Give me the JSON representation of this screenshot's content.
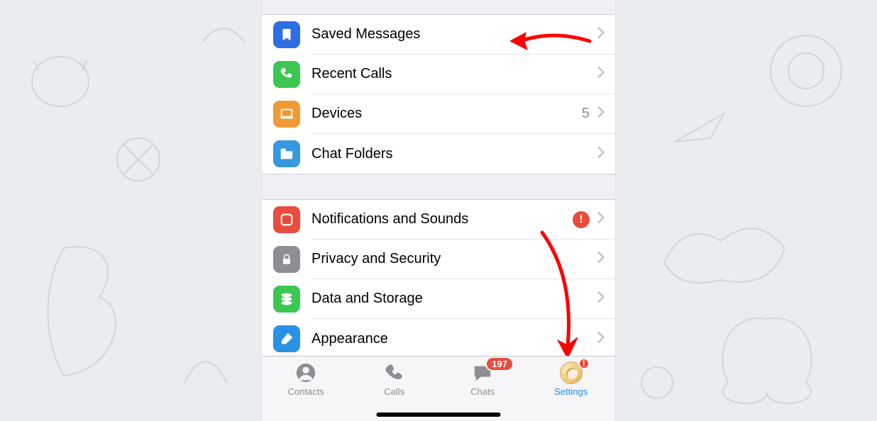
{
  "groups": [
    {
      "rows": [
        {
          "id": "saved-messages",
          "label": "Saved Messages",
          "iconClass": "ic-blue",
          "icon": "bookmark"
        },
        {
          "id": "recent-calls",
          "label": "Recent Calls",
          "iconClass": "ic-green2",
          "icon": "phone"
        },
        {
          "id": "devices",
          "label": "Devices",
          "iconClass": "ic-orange",
          "icon": "laptop",
          "detail": "5"
        },
        {
          "id": "chat-folders",
          "label": "Chat Folders",
          "iconClass": "ic-blue2",
          "icon": "folder"
        }
      ]
    },
    {
      "rows": [
        {
          "id": "notifications",
          "label": "Notifications and Sounds",
          "iconClass": "ic-red",
          "icon": "bell",
          "alert": "!"
        },
        {
          "id": "privacy",
          "label": "Privacy and Security",
          "iconClass": "ic-grey",
          "icon": "lock"
        },
        {
          "id": "data-storage",
          "label": "Data and Storage",
          "iconClass": "ic-green",
          "icon": "db"
        },
        {
          "id": "appearance",
          "label": "Appearance",
          "iconClass": "ic-blue3",
          "icon": "brush"
        }
      ]
    }
  ],
  "tabs": {
    "contacts": {
      "label": "Contacts"
    },
    "calls": {
      "label": "Calls"
    },
    "chats": {
      "label": "Chats",
      "badge": "197"
    },
    "settings": {
      "label": "Settings",
      "dot": "!"
    }
  }
}
